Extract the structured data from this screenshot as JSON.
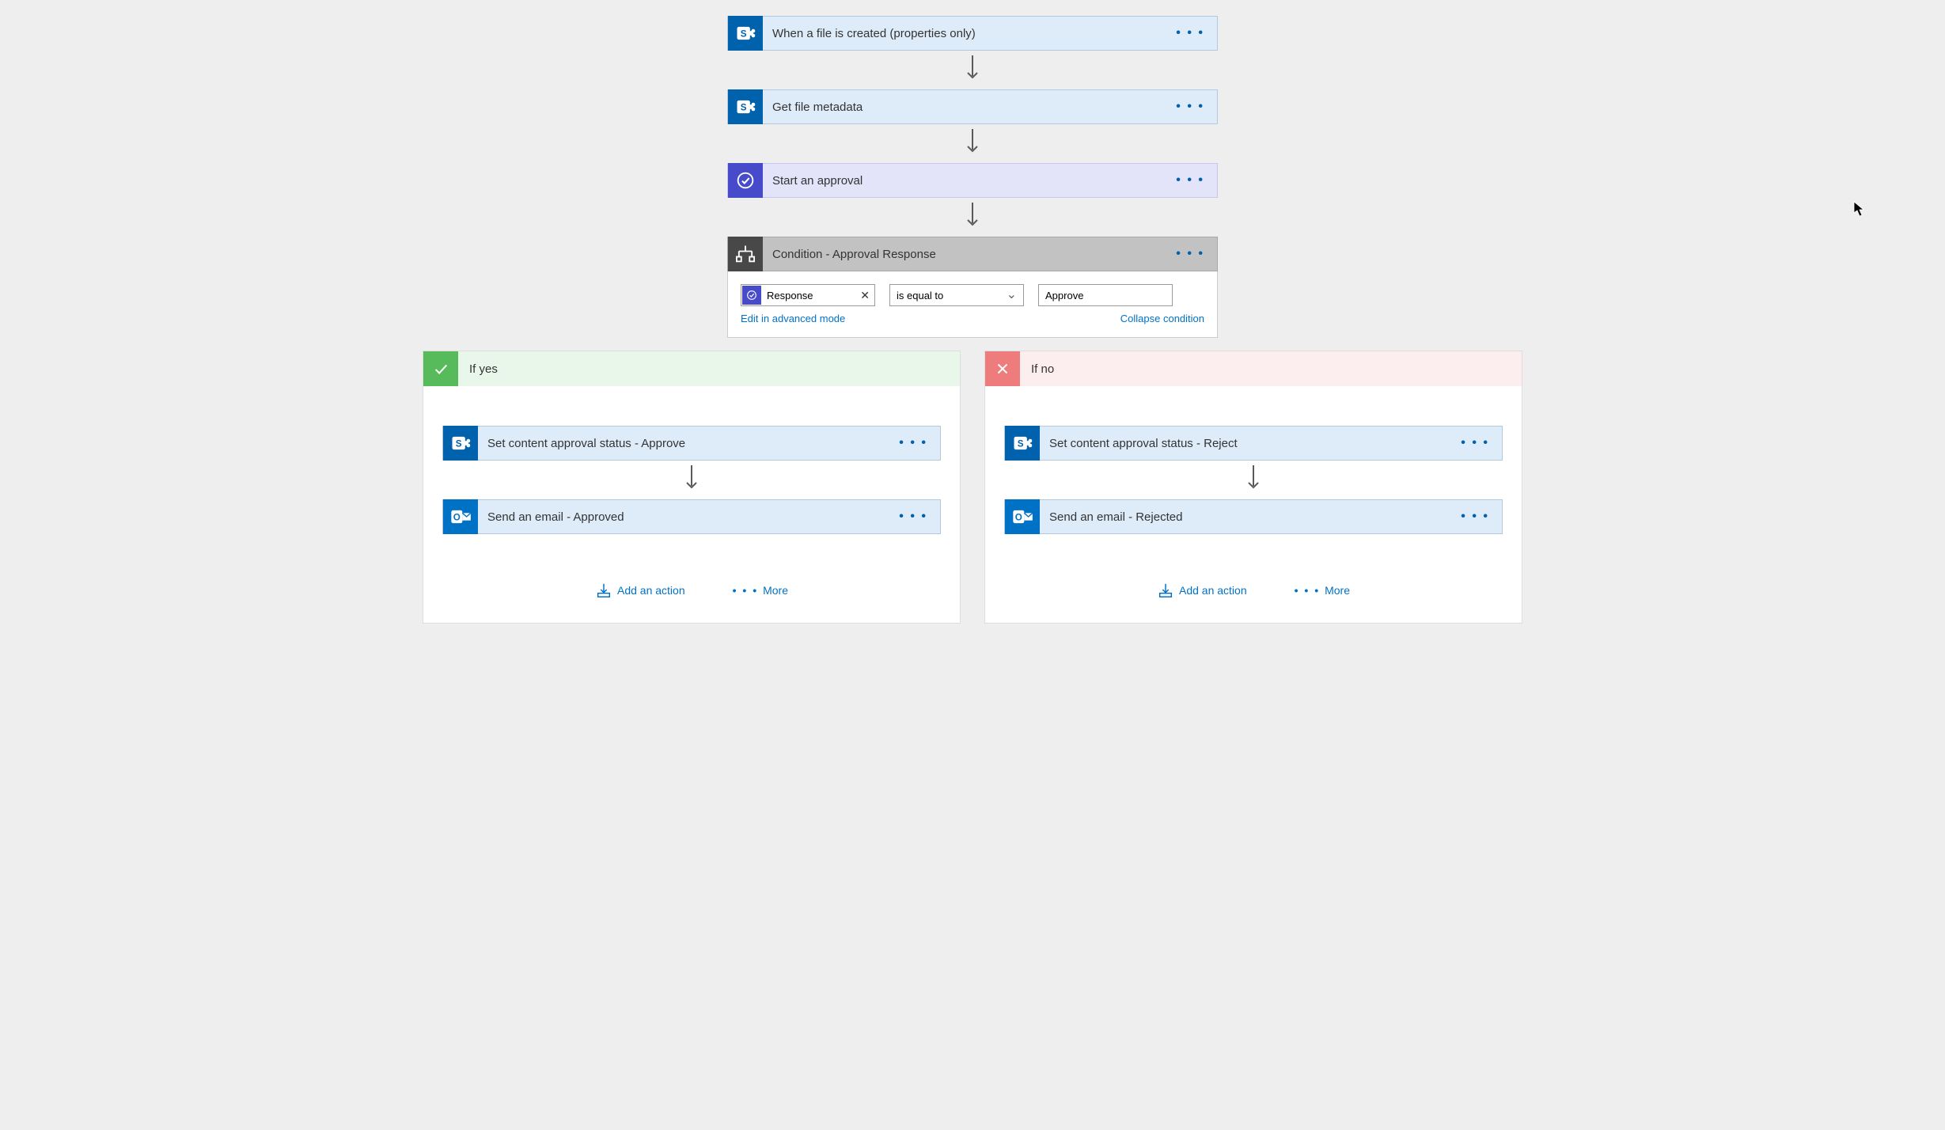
{
  "steps": [
    {
      "title": "When a file is created (properties only)",
      "icon": "sharepoint"
    },
    {
      "title": "Get file metadata",
      "icon": "sharepoint"
    },
    {
      "title": "Start an approval",
      "icon": "approval"
    },
    {
      "title": "Condition - Approval Response",
      "icon": "condition"
    }
  ],
  "condition": {
    "token_label": "Response",
    "operator": "is equal to",
    "value": "Approve",
    "edit_link": "Edit in advanced mode",
    "collapse_link": "Collapse condition"
  },
  "branches": {
    "yes": {
      "title": "If yes",
      "steps": [
        {
          "title": "Set content approval status - Approve",
          "icon": "sharepoint"
        },
        {
          "title": "Send an email - Approved",
          "icon": "outlook"
        }
      ]
    },
    "no": {
      "title": "If no",
      "steps": [
        {
          "title": "Set content approval status - Reject",
          "icon": "sharepoint"
        },
        {
          "title": "Send an email - Rejected",
          "icon": "outlook"
        }
      ]
    },
    "add_action_label": "Add an action",
    "more_label": "More"
  }
}
